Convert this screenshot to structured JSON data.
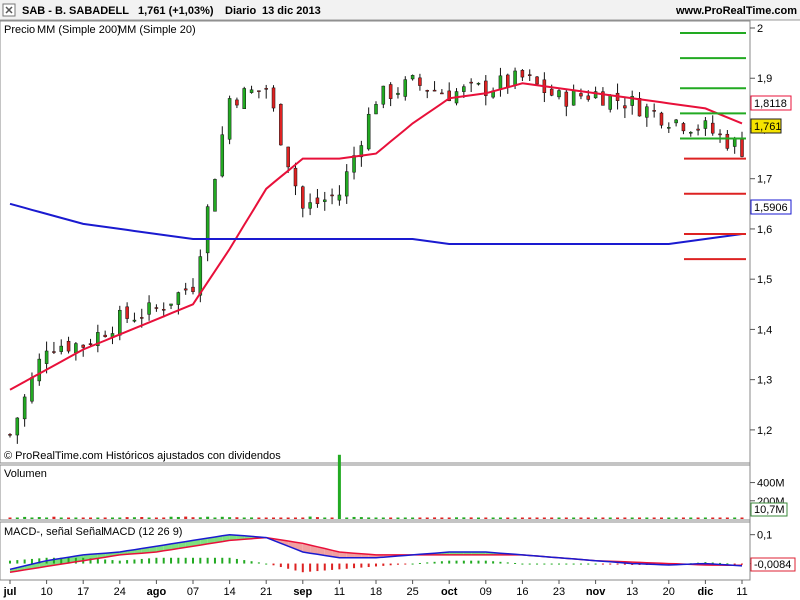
{
  "header": {
    "symbol": "SAB - B. SABADELL",
    "quote": "1,761 (+1,03%)",
    "period": "Diario",
    "date": "13 dic 2013",
    "site": "www.ProRealTime.com"
  },
  "price_panel": {
    "legend_prefix": "Precio",
    "legend_mm200": "MM (Simple 200)",
    "legend_mm20": "MM (Simple 20)",
    "footer": "© ProRealTime.com  Históricos ajustados con dividendos",
    "last_price_label": "1,761",
    "mm20_label": "1,8118",
    "mm200_label": "1,5906",
    "colors": {
      "up": "#22aa22",
      "down": "#dd2222",
      "mm20": "#e8103a",
      "mm200": "#1a1ad0"
    }
  },
  "volume_panel": {
    "title": "Volumen",
    "last_label": "10,7M",
    "axis_labels": [
      "400M",
      "200M"
    ]
  },
  "macd_panel": {
    "title_a": "MACD-, señal Señal",
    "title_b": "MACD (12 26 9)",
    "last_label": "-0,0084",
    "axis_labels": [
      "0,1",
      "0"
    ]
  },
  "x_axis": {
    "labels": [
      "jul",
      "10",
      "17",
      "24",
      "ago",
      "07",
      "14",
      "21",
      "sep",
      "11",
      "18",
      "25",
      "oct",
      "09",
      "16",
      "23",
      "nov",
      "13",
      "20",
      "dic",
      "11"
    ]
  },
  "chart_data": [
    {
      "type": "line",
      "title": "SAB - B. SABADELL",
      "x": [
        "jul",
        "10",
        "17",
        "24",
        "ago",
        "07",
        "14",
        "21",
        "sep",
        "11",
        "18",
        "25",
        "oct",
        "09",
        "16",
        "23",
        "nov",
        "13",
        "20",
        "dic",
        "11"
      ],
      "ylim": [
        1.15,
        2.0
      ],
      "y_ticks": [
        "2",
        "1,9",
        "1,8",
        "1,7",
        "1,6",
        "1,5",
        "1,4",
        "1,3",
        "1,2"
      ],
      "series": [
        {
          "name": "Precio",
          "values": [
            1.19,
            1.37,
            1.37,
            1.42,
            1.44,
            1.49,
            1.86,
            1.88,
            1.64,
            1.67,
            1.86,
            1.89,
            1.87,
            1.88,
            1.9,
            1.86,
            1.87,
            1.85,
            1.82,
            1.8,
            1.76
          ]
        },
        {
          "name": "MM (Simple 20)",
          "values": [
            1.28,
            1.32,
            1.36,
            1.39,
            1.42,
            1.45,
            1.56,
            1.68,
            1.74,
            1.74,
            1.75,
            1.81,
            1.86,
            1.87,
            1.89,
            1.88,
            1.87,
            1.86,
            1.85,
            1.84,
            1.81
          ]
        },
        {
          "name": "MM (Simple 200)",
          "values": [
            1.65,
            1.63,
            1.61,
            1.6,
            1.59,
            1.58,
            1.58,
            1.58,
            1.58,
            1.58,
            1.58,
            1.58,
            1.57,
            1.57,
            1.57,
            1.57,
            1.57,
            1.57,
            1.57,
            1.58,
            1.59
          ]
        }
      ]
    },
    {
      "type": "bar",
      "title": "Volumen",
      "categories": [
        "jul",
        "10",
        "17",
        "24",
        "ago",
        "07",
        "14",
        "21",
        "sep",
        "11",
        "18",
        "25",
        "oct",
        "09",
        "16",
        "23",
        "nov",
        "13",
        "20",
        "dic",
        "11"
      ],
      "series": [
        {
          "name": "Volumen",
          "values": [
            15,
            20,
            12,
            15,
            18,
            22,
            20,
            14,
            10,
            540,
            12,
            11,
            14,
            12,
            13,
            11,
            12,
            10,
            12,
            14,
            10.7
          ]
        }
      ]
    },
    {
      "type": "line",
      "title": "MACD (12 26 9)",
      "x": [
        "jul",
        "10",
        "17",
        "24",
        "ago",
        "07",
        "14",
        "21",
        "sep",
        "11",
        "18",
        "25",
        "oct",
        "09",
        "16",
        "23",
        "nov",
        "13",
        "20",
        "dic",
        "11"
      ],
      "ylim": [
        -0.05,
        0.13
      ],
      "series": [
        {
          "name": "MACD",
          "values": [
            -0.02,
            0.01,
            0.03,
            0.04,
            0.06,
            0.08,
            0.1,
            0.09,
            0.04,
            0.02,
            0.02,
            0.03,
            0.04,
            0.04,
            0.03,
            0.02,
            0.01,
            0.0,
            -0.005,
            0.0,
            -0.008
          ]
        },
        {
          "name": "Señal",
          "values": [
            -0.03,
            -0.01,
            0.01,
            0.03,
            0.04,
            0.06,
            0.08,
            0.09,
            0.07,
            0.04,
            0.03,
            0.03,
            0.03,
            0.03,
            0.03,
            0.02,
            0.01,
            0.005,
            0.0,
            -0.005,
            -0.006
          ]
        }
      ]
    }
  ]
}
